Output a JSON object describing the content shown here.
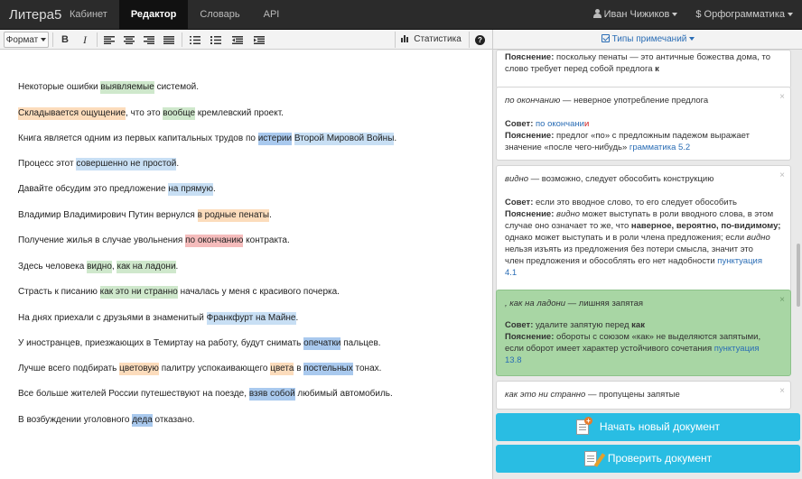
{
  "navbar": {
    "brand": "Литера5",
    "links": [
      "Кабинет",
      "Редактор",
      "Словарь",
      "API"
    ],
    "user": "Иван Чижиков",
    "spell": "$ Орфограмматика"
  },
  "toolbar": {
    "format_label": "Формат",
    "bold_label": "B",
    "italic_label": "I",
    "stats_label": "Статистика",
    "help_label": "?"
  },
  "right_panel": {
    "types_label": "Типы примечаний",
    "new_doc_label": "Начать новый документ",
    "check_doc_label": "Проверить документ"
  },
  "colors": {
    "navbar": "#2b2b2b",
    "green": "#cfe8cc",
    "orange": "#fcdcbc",
    "blue": "#a9c9ee",
    "red": "#f5bcbc",
    "light_blue": "#c8dff4",
    "card_green": "#a8d6a4",
    "action": "#29bde3",
    "link": "#2a6db5"
  },
  "icons": [
    "user-icon",
    "caret-down-icon",
    "align-left-icon",
    "align-center-icon",
    "align-right-icon",
    "align-justify-icon",
    "bullet-list-icon",
    "numbered-list-icon",
    "outdent-icon",
    "indent-icon",
    "bar-chart-icon",
    "help-icon",
    "checkbox-icon",
    "close-icon",
    "new-document-icon",
    "check-document-icon"
  ],
  "editor": {
    "paragraphs": [
      [
        [
          "Некоторые ошибки ",
          ""
        ],
        [
          "выявляемые",
          "green"
        ],
        [
          " системой.",
          ""
        ]
      ],
      [
        [
          "Складывается ощущение",
          "orange"
        ],
        [
          ", что это ",
          ""
        ],
        [
          "вообще",
          "green"
        ],
        [
          " кремлевский проект.",
          ""
        ]
      ],
      [
        [
          "Книга является одним из первых капитальных трудов по ",
          ""
        ],
        [
          "истерии",
          "blue"
        ],
        [
          " ",
          ""
        ],
        [
          "Второй Мировой Войны",
          "lblue"
        ],
        [
          ".",
          ""
        ]
      ],
      [
        [
          "Процесс этот ",
          ""
        ],
        [
          "совершенно не простой",
          "lblue"
        ],
        [
          ".",
          ""
        ]
      ],
      [
        [
          "Давайте обсудим это предложение ",
          ""
        ],
        [
          "на прямую",
          "lblue"
        ],
        [
          ".",
          ""
        ]
      ],
      [
        [
          "Владимир Владимирович Путин вернулся ",
          ""
        ],
        [
          "в родные пенаты",
          "orange"
        ],
        [
          ".",
          ""
        ]
      ],
      [
        [
          "Получение жилья в случае увольнения ",
          ""
        ],
        [
          "по окончанию",
          "red"
        ],
        [
          " контракта.",
          ""
        ]
      ],
      [
        [
          "Здесь человека ",
          ""
        ],
        [
          "видно",
          "green"
        ],
        [
          ", ",
          ""
        ],
        [
          "как на ладони",
          "green"
        ],
        [
          ".",
          ""
        ]
      ],
      [
        [
          "Страсть к писанию ",
          ""
        ],
        [
          "как это ни странно",
          "green"
        ],
        [
          " началась у меня с красивого почерка.",
          ""
        ]
      ],
      [
        [
          "На днях приехали с друзьями в знаменитый ",
          ""
        ],
        [
          "Франкфурт на Майне",
          "lblue"
        ],
        [
          ".",
          ""
        ]
      ],
      [
        [
          "У иностранцев, приезжающих в Темиртау на работу, будут снимать ",
          ""
        ],
        [
          "опечатки",
          "blue"
        ],
        [
          " пальцев.",
          ""
        ]
      ],
      [
        [
          "Лучше всего подбирать ",
          ""
        ],
        [
          "цветовую",
          "orange"
        ],
        [
          " палитру успокаивающего ",
          ""
        ],
        [
          "цвета",
          "orange"
        ],
        [
          " в ",
          ""
        ],
        [
          "постельных",
          "blue"
        ],
        [
          " тонах.",
          ""
        ]
      ],
      [
        [
          "Все больше жителей России путешествуют на поезде, ",
          ""
        ],
        [
          "взяв собой",
          "blue"
        ],
        [
          " любимый автомобиль.",
          ""
        ]
      ],
      [
        [
          "В возбуждении уголовного ",
          ""
        ],
        [
          "деда",
          "blue"
        ],
        [
          " отказано.",
          ""
        ]
      ]
    ]
  },
  "cards": [
    {
      "close": "",
      "title": [],
      "lines": [
        [
          [
            "Пояснение:",
            "b"
          ],
          [
            " поскольку пенаты — это античные божества дома, то",
            ""
          ]
        ],
        [
          [
            "слово требует перед собой предлога ",
            ""
          ],
          [
            "к",
            "b"
          ]
        ]
      ]
    },
    {
      "close": "×",
      "title": [
        [
          "по окончанию",
          "i"
        ],
        [
          " — неверное употребление предлога",
          "n"
        ]
      ],
      "lines": [
        [
          [
            "Совет:",
            "b"
          ],
          [
            " ",
            ""
          ],
          [
            "по окончани",
            "link"
          ],
          [
            "и",
            "red"
          ]
        ],
        [
          [
            "Пояснение:",
            "b"
          ],
          [
            " предлог «по» с предложным падежом выражает",
            ""
          ]
        ],
        [
          [
            "значение «после чего-нибудь» ",
            ""
          ],
          [
            "грамматика 5.2",
            "link"
          ]
        ]
      ]
    },
    {
      "close": "×",
      "title": [
        [
          "видно",
          "i"
        ],
        [
          " — возможно, следует обособить конструкцию",
          "n"
        ]
      ],
      "lines": [
        [
          [
            "Совет:",
            "b"
          ],
          [
            " если это вводное слово, то его следует обособить",
            ""
          ]
        ],
        [
          [
            "Пояснение:",
            "b"
          ],
          [
            " ",
            ""
          ],
          [
            "видно",
            "i"
          ],
          [
            " может выступать в роли вводного слова, в этом",
            ""
          ]
        ],
        [
          [
            "случае оно означает то же, что ",
            ""
          ],
          [
            "наверное, вероятно, по-видимому;",
            "b"
          ]
        ],
        [
          [
            "однако может выступать и в роли члена предложения; если ",
            ""
          ],
          [
            "видно",
            "i"
          ]
        ],
        [
          [
            "нельзя изъять из предложения без потери смысла, значит это",
            ""
          ]
        ],
        [
          [
            "член предложения и обособлять его нет надобности ",
            ""
          ],
          [
            "пунктуация",
            "link"
          ]
        ],
        [
          [
            "4.1",
            "link"
          ]
        ]
      ]
    },
    {
      "close": "×",
      "title": [
        [
          ", как на ладони",
          "i"
        ],
        [
          " — лишняя запятая",
          "n"
        ]
      ],
      "lines": [
        [
          [
            "Совет:",
            "b"
          ],
          [
            " удалите запятую перед ",
            ""
          ],
          [
            "как",
            "b"
          ]
        ],
        [
          [
            "Пояснение:",
            "b"
          ],
          [
            " обороты с союзом «как» не выделяются запятыми,",
            ""
          ]
        ],
        [
          [
            "если оборот имеет характер устойчивого сочетания ",
            ""
          ],
          [
            "пунктуация",
            "link"
          ]
        ],
        [
          [
            "13.8",
            "link"
          ]
        ]
      ]
    },
    {
      "close": "×",
      "title": [
        [
          "как это ни странно",
          "i"
        ],
        [
          " — пропущены запятые",
          "n"
        ]
      ],
      "lines": []
    }
  ]
}
